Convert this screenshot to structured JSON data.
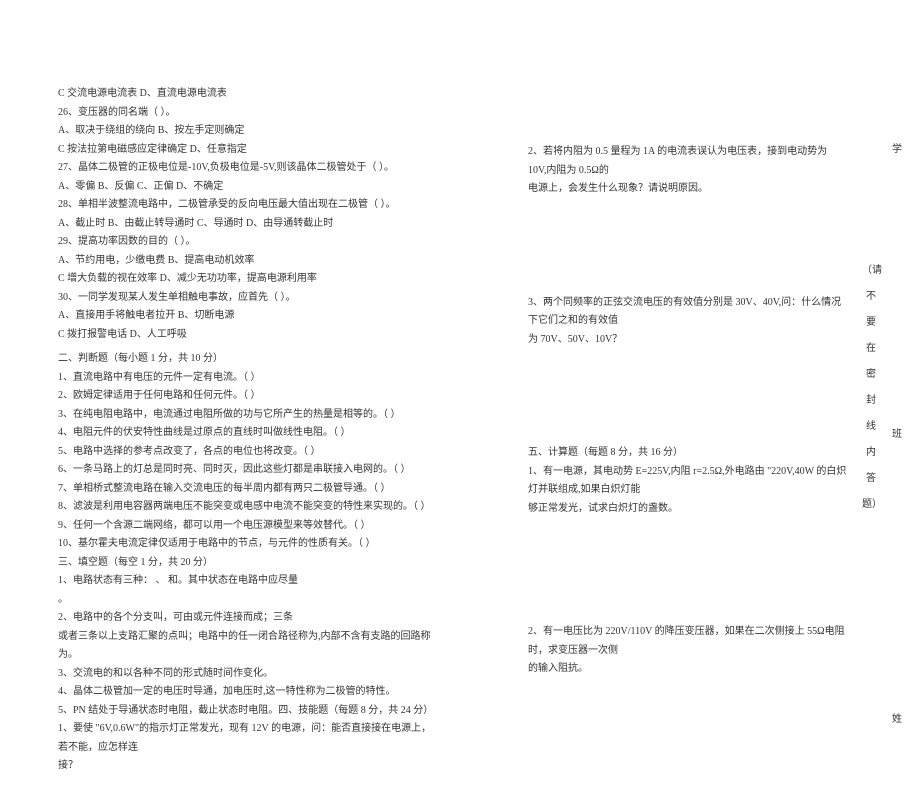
{
  "left": {
    "q25c": "C 交流电源电流表 D、直流电源电流表",
    "q26": "26、变压器的同名端（ ）。",
    "q26a": "A、取决于绕组的绕向 B、按左手定则确定",
    "q26c": "C 按法拉第电磁感应定律确定 D、任意指定",
    "q27": "27、晶体二极管的正极电位是-10V,负极电位是-5V,则该晶体二极管处于（ ）。",
    "q27a": "A、零偏 B、反偏 C、正偏 D、不确定",
    "q28": "28、单相半波整流电路中，二极管承受的反向电压最大值出现在二极管（ ）。",
    "q28a": "A、截止时 B、由截止转导通时 C、导通时 D、由导通转截止时",
    "q29": "29、提高功率因数的目的（ ）。",
    "q29a": "A、节约用电，少缴电费 B、提高电动机效率",
    "q29c": "C 增大负载的视在效率 D、减少无功功率，提高电源利用率",
    "q30": "30、一同学发现某人发生单相触电事故，应首先（ ）。",
    "q30a": "A、直接用手将触电者拉开 B、切断电源",
    "q30c": "C 拨打报警电话 D、人工呼吸",
    "s2title": "二、判断题（每小题 1 分，共 10 分）",
    "j1": "1、直流电路中有电压的元件一定有电流。（ ）",
    "j2": "2、欧姆定律适用于任何电路和任何元件。（ ）",
    "j3": "3、在纯电阻电路中，电流通过电阻所做的功与它所产生的热量是相等的。（ ）",
    "j4": "4、电阻元件的伏安特性曲线是过原点的直线时叫做线性电阻。（ ）",
    "j5": "5、电路中选择的参考点改变了，各点的电位也将改变。（ ）",
    "j6": "6、一条马路上的灯总是同时亮、同时灭，因此这些灯都是串联接入电网的。（ ）",
    "j7": "7、单相桥式整流电路在输入交流电压的每半周内都有两只二极管导通。（ ）",
    "j8": "8、滤波是利用电容器两端电压不能突变或电感中电流不能突变的特性来实现的。（ ）",
    "j9": "9、任何一个含源二端网络，都可以用一个电压源模型来等效替代。（ ）",
    "j10": "10、基尔霍夫电流定律仅适用于电路中的节点，与元件的性质有关。（ ）",
    "s3title": "三、填空题（每空 1 分，共 20 分）",
    "f1": "1、电路状态有三种： 、 和。其中状态在电路中应尽量",
    "f1b": "。",
    "f2": "2、电路中的各个分支叫，可由或元件连接而成；三条",
    "f2b": "或者三条以上支路汇聚的点叫；电路中的任一闭合路径称为,内部不含有支路的回路称为。",
    "f3": "3、交流电的和以各种不同的形式随时间作变化。",
    "f4": "4、晶体二极管加一定的电压时导通，加电压时,这一特性称为二极管的特性。",
    "f5": "5、PN 结处于导通状态时电阻，截止状态时电阻。四、技能题（每题 8 分，共 24 分）",
    "skill1": "1、要使 \"6V,0.6W\"的指示灯正常发光，现有 12V 的电源，问：能否直接接在电源上，若不能，应怎样连",
    "skill1b": "接？"
  },
  "right": {
    "r2": "2、若将内阻为 0.5 量程为 1A 的电流表误认为电压表，接到电动势为 10V,内阻为 0.5Ω的",
    "r2b": "电源上，会发生什么现象？请说明原因。",
    "r3": "3、两个同频率的正弦交流电压的有效值分别是 30V、40V,问：什么情况下它们之和的有效值",
    "r3b": "为 70V、50V、10V？",
    "s5title": "五、计算题（每题 8 分，共 16 分）",
    "c1": "1、有一电源，其电动势 E=225V,内阻 r=2.5Ω,外电路由 \"220V,40W 的白炽灯并联组成,如果白炽灯能",
    "c1b": "够正常发光，试求白炽灯的盏数。",
    "c2": "2、有一电压比为 220V/110V 的降压变压器，如果在二次侧接上 55Ω电阻时，求变压器一次侧",
    "c2b": "的输入阻抗。"
  },
  "vnotes": {
    "n0": "（请",
    "n1": "不",
    "n2": "要",
    "n3": "在",
    "n4": "密",
    "n5": "封",
    "n6": "线",
    "n7": "内",
    "n8": "答",
    "n9": "题）"
  },
  "vright": {
    "r1": "学",
    "r2": "班",
    "r3": "姓"
  }
}
